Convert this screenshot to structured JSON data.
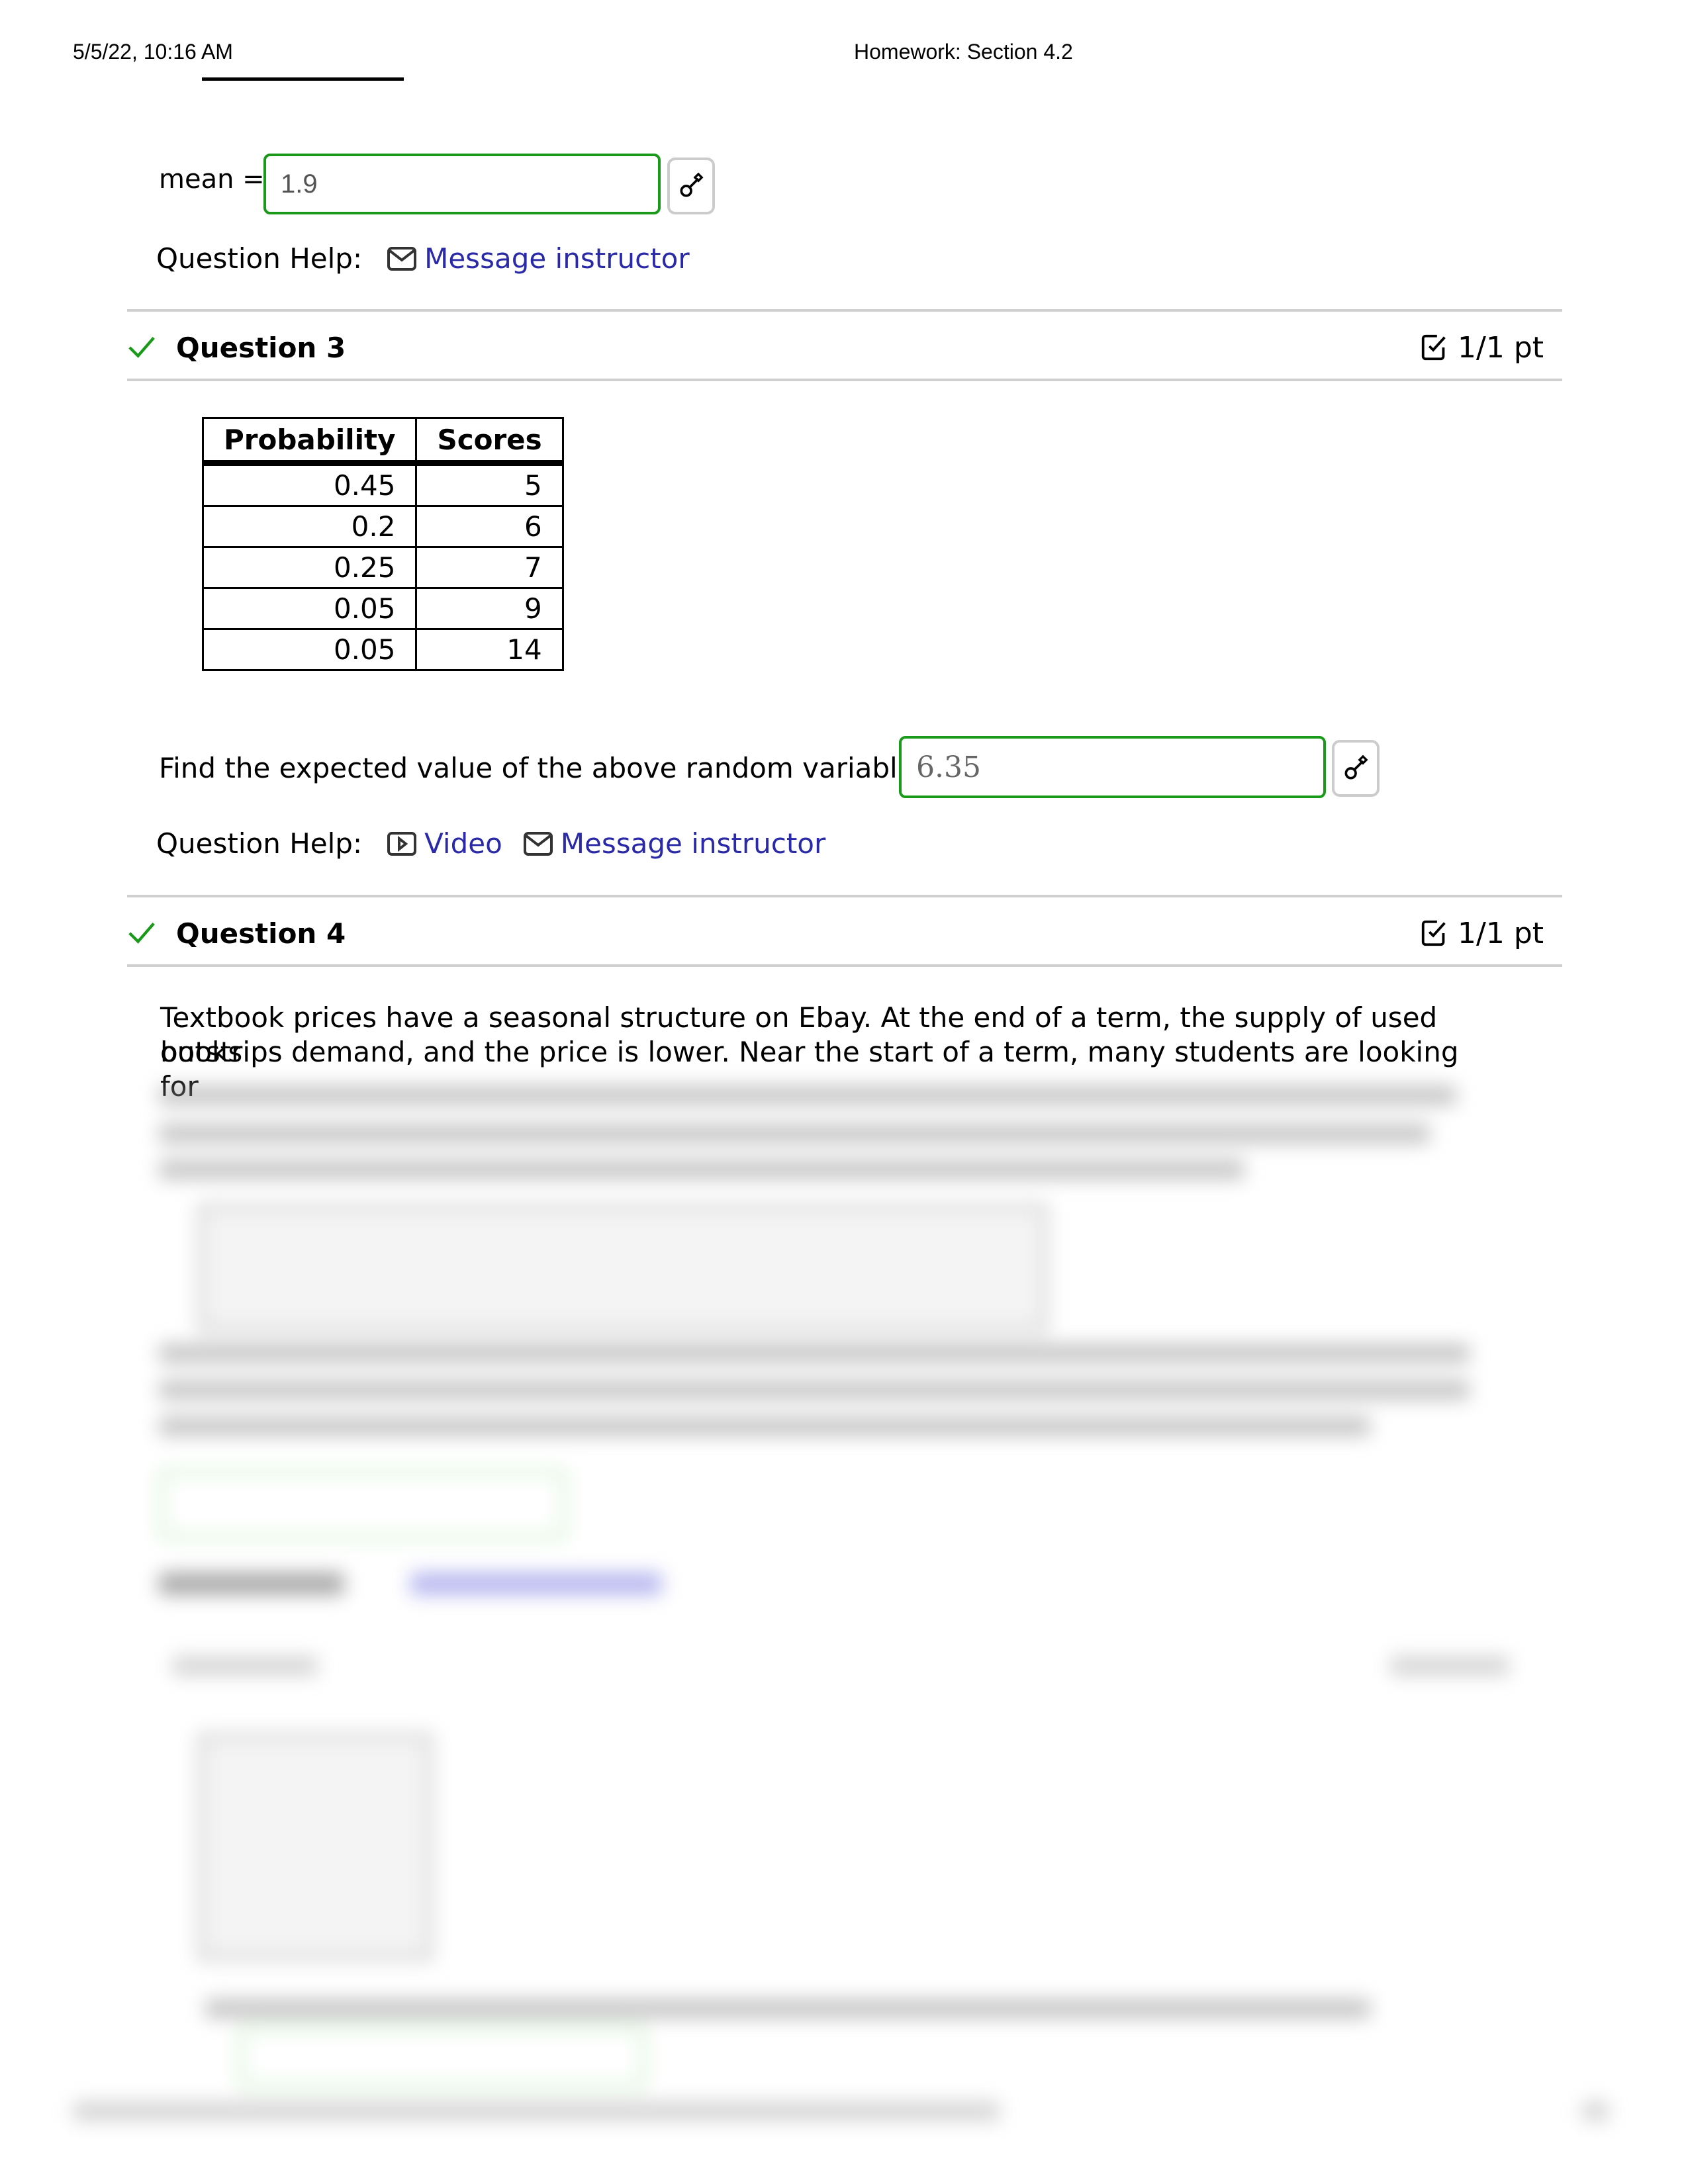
{
  "print_header": {
    "datetime": "5/5/22, 10:16 AM",
    "title": "Homework: Section 4.2"
  },
  "question2_tail": {
    "label": "mean =",
    "answer_value": "1.9",
    "help_label": "Question Help:",
    "help_links": [
      {
        "icon": "mail-icon",
        "label": "Message instructor"
      }
    ]
  },
  "question3": {
    "title": "Question 3",
    "status_icon": "checkmark-icon",
    "score": "1/1 pt",
    "table": {
      "headers": [
        "Probability",
        "Scores"
      ],
      "rows": [
        [
          "0.45",
          "5"
        ],
        [
          "0.2",
          "6"
        ],
        [
          "0.25",
          "7"
        ],
        [
          "0.05",
          "9"
        ],
        [
          "0.05",
          "14"
        ]
      ]
    },
    "prompt": "Find the expected value of the above random variable.",
    "answer_value": "6.35",
    "help_label": "Question Help:",
    "help_links": [
      {
        "icon": "video-icon",
        "label": "Video"
      },
      {
        "icon": "mail-icon",
        "label": "Message instructor"
      }
    ]
  },
  "question4": {
    "title": "Question 4",
    "status_icon": "checkmark-icon",
    "score": "1/1 pt",
    "text_line1": "Textbook prices have a seasonal structure on Ebay. At the end of a term, the supply of used books",
    "text_line2": "outstrips demand, and the price is lower. Near the start of a term, many students are looking for"
  },
  "colors": {
    "correct_green": "#1a9a1a",
    "link_blue": "#2a2aa8",
    "rule_gray": "#d0d0d0"
  }
}
